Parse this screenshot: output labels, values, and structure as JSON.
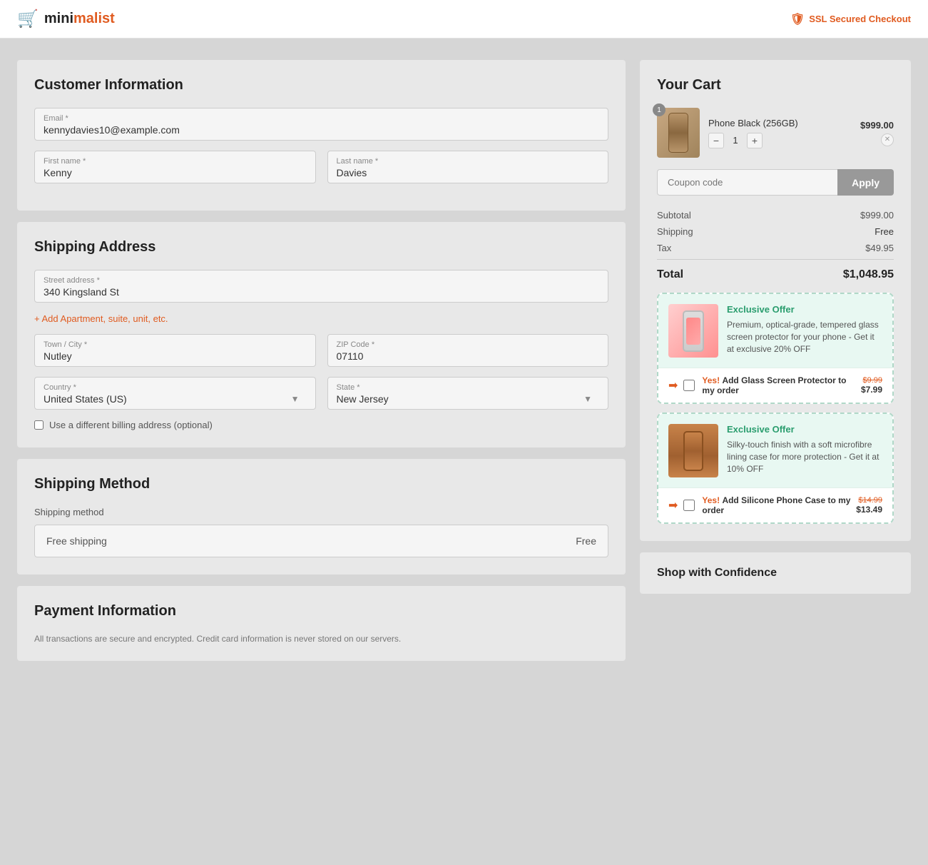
{
  "header": {
    "logo_mini": "mini",
    "logo_malist": "malist",
    "ssl_text": "SSL Secured Checkout"
  },
  "customer_info": {
    "section_title": "Customer Information",
    "email_label": "Email *",
    "email_value": "kennydavies10@example.com",
    "first_name_label": "First name *",
    "first_name_value": "Kenny",
    "last_name_label": "Last name *",
    "last_name_value": "Davies"
  },
  "shipping_address": {
    "section_title": "Shipping Address",
    "street_label": "Street address *",
    "street_value": "340 Kingsland St",
    "add_apartment_text": "Add Apartment, suite, unit, etc.",
    "city_label": "Town / City *",
    "city_value": "Nutley",
    "zip_label": "ZIP Code *",
    "zip_value": "07110",
    "country_label": "Country *",
    "country_value": "United States (US)",
    "state_label": "State *",
    "state_value": "New Jersey",
    "billing_checkbox_label": "Use a different billing address (optional)"
  },
  "shipping_method": {
    "section_title": "Shipping Method",
    "method_label": "Shipping method",
    "option_text": "Free shipping",
    "option_price": "Free"
  },
  "payment": {
    "section_title": "Payment Information",
    "note_text": "All transactions are secure and encrypted. Credit card information is never stored on our servers."
  },
  "cart": {
    "title": "Your Cart",
    "item": {
      "name": "Phone Black (256GB)",
      "price": "$999.00",
      "qty": "1",
      "badge": "1"
    },
    "coupon_placeholder": "Coupon code",
    "apply_btn": "Apply",
    "subtotal_label": "Subtotal",
    "subtotal_value": "$999.00",
    "shipping_label": "Shipping",
    "shipping_value": "Free",
    "tax_label": "Tax",
    "tax_value": "$49.95",
    "total_label": "Total",
    "total_value": "$1,048.95"
  },
  "offers": [
    {
      "badge": "Exclusive Offer",
      "description": "Premium, optical-grade, tempered glass screen protector for your phone - Get it at exclusive 20% OFF",
      "yes_text": "Yes!",
      "add_text": "Add Glass Screen Protector to my order",
      "original_price": "$9.99",
      "sale_price": "$7.99"
    },
    {
      "badge": "Exclusive Offer",
      "description": "Silky-touch finish with a soft microfibre lining case for more protection - Get it at 10% OFF",
      "yes_text": "Yes!",
      "add_text": "Add Silicone Phone Case to my order",
      "original_price": "$14.99",
      "sale_price": "$13.49"
    }
  ],
  "shop_confidence": {
    "title": "Shop with Confidence"
  }
}
